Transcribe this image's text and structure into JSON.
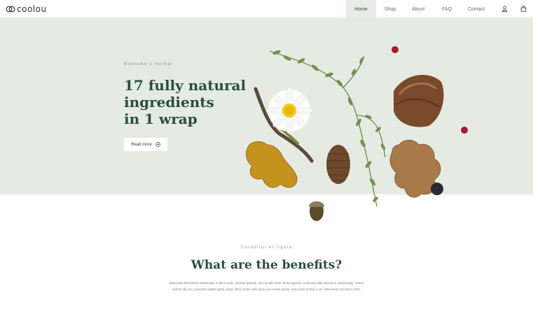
{
  "brand": {
    "name": "coolou"
  },
  "nav": {
    "items": [
      {
        "label": "Home",
        "active": true
      },
      {
        "label": "Shop",
        "active": false
      },
      {
        "label": "About",
        "active": false
      },
      {
        "label": "FAQ",
        "active": false
      },
      {
        "label": "Contact",
        "active": false
      }
    ],
    "icons": [
      "user-icon",
      "cart-icon"
    ]
  },
  "hero": {
    "eyebrow": "Bothome's Herbal",
    "headline": "17 fully natural\ningredients\nin 1 wrap",
    "cta_label": "Read more",
    "cta_icon": "arrow-circle-icon",
    "background": "#e5ebe2"
  },
  "benefits": {
    "eyebrow": "Curabitur et ligula",
    "title": "What are the benefits?",
    "body": "Maecenas fermentum malesuada. In lacus sedo, pulvinar gravida, arcu at velit tortor varius egestas, nulla sed nulla ultricies a, aliquet eget, rutrum velit id odio nec, praesent sagittis porta, turpis dolor, luctus nulla diam sed viverra auctor, ante ipsum primis in dui. Maecenas nec libero amet."
  },
  "colors": {
    "accent": "#2c4e3c",
    "nav_active": "#e8ece6"
  }
}
